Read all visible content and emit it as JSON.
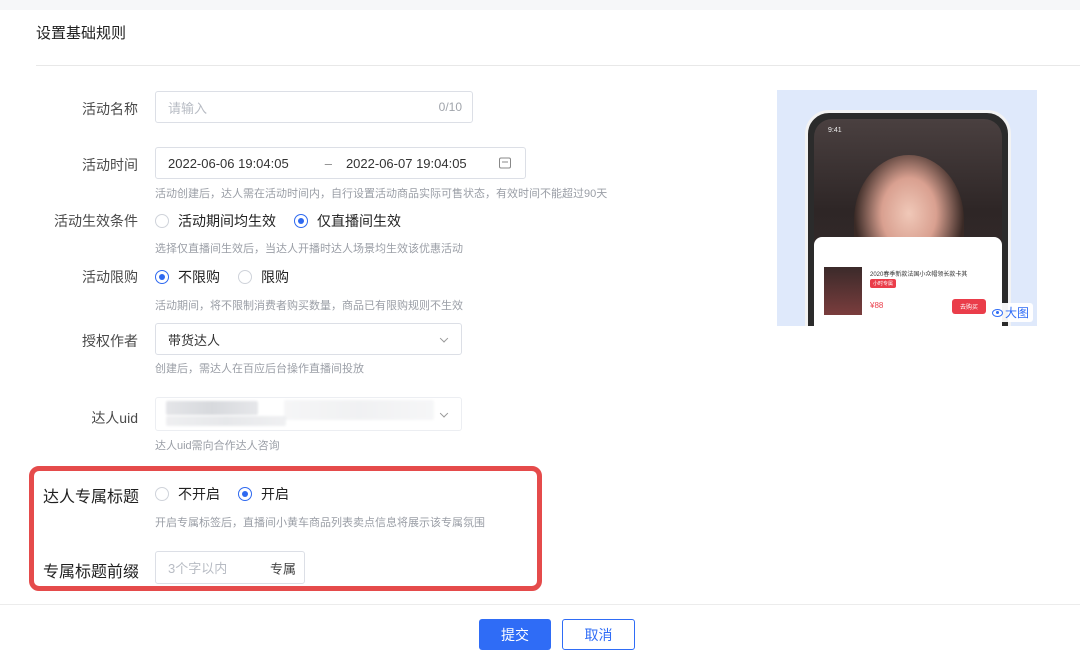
{
  "section": {
    "title": "设置基础规则"
  },
  "activity_name": {
    "label": "活动名称",
    "placeholder": "请输入",
    "counter": "0/10"
  },
  "activity_time": {
    "label": "活动时间",
    "start": "2022-06-06 19:04:05",
    "separator": "–",
    "end": "2022-06-07 19:04:05",
    "hint": "活动创建后，达人需在活动时间内，自行设置活动商品实际可售状态，有效时间不能超过90天"
  },
  "effective_condition": {
    "label": "活动生效条件",
    "options": [
      "活动期间均生效",
      "仅直播间生效"
    ],
    "selected_index": 1,
    "hint": "选择仅直播间生效后，当达人开播时达人场景均生效该优惠活动"
  },
  "purchase_limit": {
    "label": "活动限购",
    "options": [
      "不限购",
      "限购"
    ],
    "selected_index": 0,
    "hint": "活动期间，将不限制消费者购买数量，商品已有限购规则不生效"
  },
  "authorized_author": {
    "label": "授权作者",
    "value": "带货达人",
    "hint": "创建后，需达人在百应后台操作直播间投放"
  },
  "creator_uid": {
    "label": "达人uid",
    "hint": "达人uid需向合作达人咨询"
  },
  "exclusive_title": {
    "label": "达人专属标题",
    "options": [
      "不开启",
      "开启"
    ],
    "selected_index": 1,
    "hint": "开启专属标签后，直播间小黄车商品列表卖点信息将展示该专属氛围"
  },
  "title_prefix": {
    "label": "专属标题前缀",
    "placeholder": "3个字以内",
    "suffix": "专属"
  },
  "preview": {
    "zoom_label": "大图",
    "time": "9:41",
    "card_title": "2020春季新款法国小众帽领长款卡其",
    "card_tag": "小时专属",
    "price": "¥88",
    "buy": "去购买"
  },
  "actions": {
    "submit": "提交",
    "cancel": "取消"
  },
  "colors": {
    "accent": "#2f6cf6",
    "highlight": "#e54b4b"
  }
}
